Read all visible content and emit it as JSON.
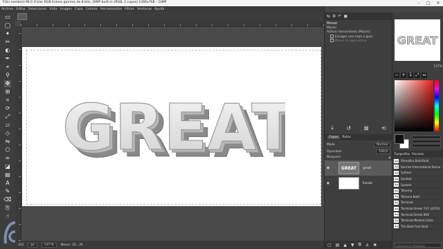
{
  "window": {
    "title": "*[Sin nombre]-96.0 (Color RGB Entero gamma de 8 bits, GIMP built-in sRGB, 2 capas) 1366x768 – GIMP",
    "controls": [
      "–",
      "□",
      "✕"
    ]
  },
  "menu": [
    "Archivo",
    "Editar",
    "Seleccionar",
    "Vista",
    "Imagen",
    "Capa",
    "Colores",
    "Herramientas",
    "Filtros",
    "Ventanas",
    "Ayuda"
  ],
  "canvas": {
    "artwork_text": "GREAT"
  },
  "statusbar": {
    "coords": "335",
    "unit": "px",
    "zoom": "137 %",
    "message": "Mover: 35, -35"
  },
  "tool_options": {
    "panel_title": "Mover",
    "mode_label": "Mover:",
    "toggle_label": "Activar herramienta (Mayús)",
    "option1": "Escoger una capa o guía",
    "option2": "Mover la capa activa"
  },
  "layers": {
    "tabs": [
      "Capas",
      "Rutas"
    ],
    "mode_label": "Modo",
    "mode_value": "Normal",
    "opacity_label": "Opacidad",
    "opacity_value": "100,0",
    "lock_label": "Bloquear:",
    "items": [
      {
        "name": "great",
        "thumb_text": "GREAT"
      },
      {
        "name": "Fondo",
        "thumb_text": ""
      }
    ]
  },
  "navigator": {
    "preview_text": "GREAT",
    "zoom": "137%"
  },
  "fonts": {
    "tabs": [
      "Tipografías",
      "Pinceles"
    ],
    "list": [
      "Shmolika Bold-Bold",
      "Sonrise International Demo",
      "Sylfaen",
      "Symbol",
      "System",
      "Tahoma",
      "Tahoma Bold",
      "Terminal",
      "Terminal Greek 737 (437G)",
      "Terminal Greek 869",
      "Terminal Medium Italic",
      "The Bold Font Bold"
    ],
    "search_placeholder": "introduzca etiquetas"
  }
}
